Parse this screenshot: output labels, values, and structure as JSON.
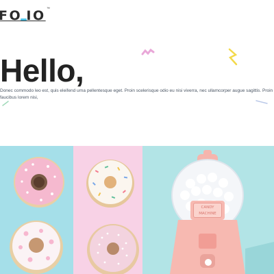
{
  "brand": {
    "name": "FOLIO",
    "logo_text": "FO IO",
    "trademark": "™",
    "accent": "#4fc3e8"
  },
  "hero": {
    "title": "Hello,",
    "body": "Donec commodo leo est, quis eleifend urna pellentesque eget. Proin scelerisque odio eu nisi viverra, nec ullamcorper augue sagittis. Proin faucibus lorem nisi,"
  },
  "gallery": {
    "sign_line1": "CANDY",
    "sign_line2": "MACHINE",
    "colors": {
      "blue": "#a5dfe9",
      "pink": "#f8d2e6",
      "teal": "#b2e4e6"
    }
  }
}
